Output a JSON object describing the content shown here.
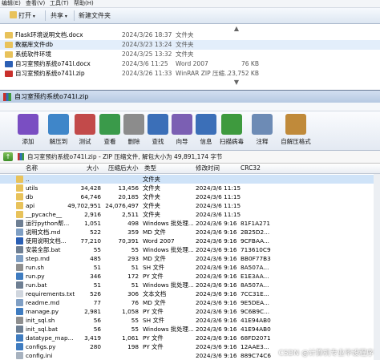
{
  "explorer": {
    "menu": [
      "编辑(E)",
      "查看(V)",
      "工具(T)",
      "帮助(H)"
    ],
    "toolbar": {
      "open_label": "打开",
      "share_label": "共享",
      "new_folder_label": "新建文件夹"
    },
    "files": [
      {
        "name": "Flask环境说明文档.docx",
        "date": "2024/3/26 18:37",
        "type": "文件夹",
        "size": ""
      },
      {
        "name": "数据库文件db",
        "date": "2024/3/23 13:24",
        "type": "文件夹",
        "size": ""
      },
      {
        "name": "系统软件环境",
        "date": "2024/3/25 13:32",
        "type": "文件夹",
        "size": ""
      },
      {
        "name": "自习室预约系统o741l.docx",
        "date": "2024/3/6 11:25",
        "type": "Word 2007",
        "size": "76 KB"
      },
      {
        "name": "自习室预约系统o741l.zip",
        "date": "2024/3/26 11:33",
        "type": "WinRAR ZIP 压缩...",
        "size": "23,752 KB"
      }
    ]
  },
  "winrar": {
    "title": "自习室预约系统o741l.zip",
    "menu": [],
    "tools": [
      {
        "label": "添加",
        "icon": "add-icon",
        "color": "#7a4ec2"
      },
      {
        "label": "解压到",
        "icon": "extract-to-icon",
        "color": "#3f86c9"
      },
      {
        "label": "测试",
        "icon": "test-icon",
        "color": "#c24a4a"
      },
      {
        "label": "查看",
        "icon": "view-icon",
        "color": "#3a9a4a"
      },
      {
        "label": "删除",
        "icon": "delete-icon",
        "color": "#8c8c8c"
      },
      {
        "label": "查找",
        "icon": "find-icon",
        "color": "#3b6fb8"
      },
      {
        "label": "向导",
        "icon": "wizard-icon",
        "color": "#7b5fb3"
      },
      {
        "label": "信息",
        "icon": "info-icon",
        "color": "#3b6fb8"
      },
      {
        "label": "扫描病毒",
        "icon": "scan-virus-icon",
        "color": "#3e9a3e"
      },
      {
        "label": "注释",
        "icon": "comment-icon",
        "color": "#6d8bb5"
      },
      {
        "label": "自解压格式",
        "icon": "sfx-icon",
        "color": "#c08a3a"
      }
    ],
    "path": "自习室预约系统o741l.zip - ZIP 压缩文件, 解包大小为 49,891,174 字节",
    "columns": {
      "name": "名称",
      "size": "大小",
      "packed": "压缩后大小",
      "type": "类型",
      "modified": "修改时间",
      "crc": "CRC32"
    },
    "rows": [
      {
        "name": "..",
        "size": "",
        "packed": "",
        "type": "文件夹",
        "modified": "",
        "crc": "",
        "kind": "folder",
        "selected": true
      },
      {
        "name": "utils",
        "size": "34,428",
        "packed": "13,456",
        "type": "文件夹",
        "modified": "2024/3/6 11:15",
        "crc": "",
        "kind": "folder"
      },
      {
        "name": "db",
        "size": "64,746",
        "packed": "20,185",
        "type": "文件夹",
        "modified": "2024/3/6 11:15",
        "crc": "",
        "kind": "folder"
      },
      {
        "name": "api",
        "size": "49,702,951",
        "packed": "24,076,497",
        "type": "文件夹",
        "modified": "2024/3/6 11:15",
        "crc": "",
        "kind": "folder"
      },
      {
        "name": "__pycache__",
        "size": "2,916",
        "packed": "2,511",
        "type": "文件夹",
        "modified": "2024/3/6 11:15",
        "crc": "",
        "kind": "folder"
      },
      {
        "name": "运行python帮...",
        "size": "1,051",
        "packed": "498",
        "type": "Windows 批处理...",
        "modified": "2024/3/6 9:16",
        "crc": "81F1A271",
        "kind": "bat"
      },
      {
        "name": "说明文档.md",
        "size": "522",
        "packed": "359",
        "type": "MD 文件",
        "modified": "2024/3/6 9:16",
        "crc": "2B25D2...",
        "kind": "md"
      },
      {
        "name": "使用说明文档...",
        "size": "77,210",
        "packed": "70,391",
        "type": "Word 2007",
        "modified": "2024/3/6 9:16",
        "crc": "9CFBAA...",
        "kind": "doc"
      },
      {
        "name": "安装全部.bat",
        "size": "55",
        "packed": "55",
        "type": "Windows 批处理...",
        "modified": "2024/3/6 9:16",
        "crc": "713610C9",
        "kind": "bat"
      },
      {
        "name": "step.md",
        "size": "485",
        "packed": "293",
        "type": "MD 文件",
        "modified": "2024/3/6 9:16",
        "crc": "BB0F77B3",
        "kind": "md"
      },
      {
        "name": "run.sh",
        "size": "51",
        "packed": "51",
        "type": "SH 文件",
        "modified": "2024/3/6 9:16",
        "crc": "8A507A...",
        "kind": "sh"
      },
      {
        "name": "run.py",
        "size": "346",
        "packed": "172",
        "type": "PY 文件",
        "modified": "2024/3/6 9:16",
        "crc": "E1E3AA...",
        "kind": "py"
      },
      {
        "name": "run.bat",
        "size": "51",
        "packed": "51",
        "type": "Windows 批处理...",
        "modified": "2024/3/6 9:16",
        "crc": "8A507A...",
        "kind": "bat"
      },
      {
        "name": "requirements.txt",
        "size": "526",
        "packed": "306",
        "type": "文本文档",
        "modified": "2024/3/6 9:16",
        "crc": "7CC31E...",
        "kind": "txt"
      },
      {
        "name": "readme.md",
        "size": "77",
        "packed": "76",
        "type": "MD 文件",
        "modified": "2024/3/6 9:16",
        "crc": "9E5DEA...",
        "kind": "md"
      },
      {
        "name": "manage.py",
        "size": "2,981",
        "packed": "1,058",
        "type": "PY 文件",
        "modified": "2024/3/6 9:16",
        "crc": "9C6B9C...",
        "kind": "py"
      },
      {
        "name": "init_sql.sh",
        "size": "56",
        "packed": "55",
        "type": "SH 文件",
        "modified": "2024/3/6 9:16",
        "crc": "41E94AB0",
        "kind": "sh"
      },
      {
        "name": "init_sql.bat",
        "size": "56",
        "packed": "55",
        "type": "Windows 批处理...",
        "modified": "2024/3/6 9:16",
        "crc": "41E94AB0",
        "kind": "bat"
      },
      {
        "name": "datatype_map...",
        "size": "3,419",
        "packed": "1,061",
        "type": "PY 文件",
        "modified": "2024/3/6 9:16",
        "crc": "68FD2071",
        "kind": "py"
      },
      {
        "name": "configs.py",
        "size": "280",
        "packed": "198",
        "type": "PY 文件",
        "modified": "2024/3/6 9:16",
        "crc": "12AAE3...",
        "kind": "py"
      },
      {
        "name": "config.ini",
        "size": "",
        "packed": "",
        "type": "",
        "modified": "2024/3/6 9:16",
        "crc": "889C74C6",
        "kind": "ini"
      }
    ]
  },
  "watermark": "CSDN @计算机专业毕设程序"
}
